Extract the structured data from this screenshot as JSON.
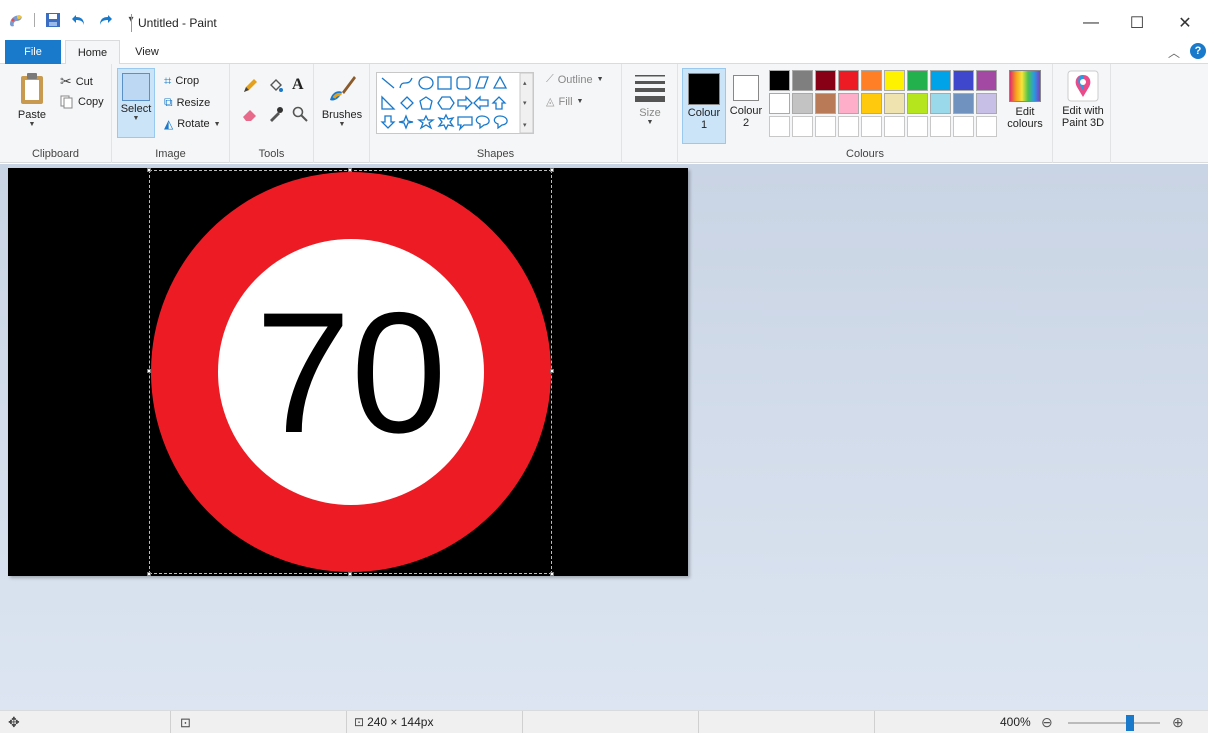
{
  "window": {
    "title": "Untitled - Paint"
  },
  "tabs": [
    {
      "label": "File"
    },
    {
      "label": "Home"
    },
    {
      "label": "View"
    }
  ],
  "ribbon": {
    "clipboard": {
      "group_label": "Clipboard",
      "paste": "Paste",
      "cut": "Cut",
      "copy": "Copy"
    },
    "image": {
      "group_label": "Image",
      "select": "Select",
      "crop": "Crop",
      "resize": "Resize",
      "rotate": "Rotate"
    },
    "tools": {
      "group_label": "Tools"
    },
    "brushes": {
      "label": "Brushes"
    },
    "shapes": {
      "group_label": "Shapes",
      "outline": "Outline",
      "fill": "Fill"
    },
    "size": {
      "label": "Size"
    },
    "colours": {
      "group_label": "Colours",
      "colour1": "Colour",
      "colour1_num": "1",
      "colour2": "Colour",
      "colour2_num": "2",
      "edit_colours_1": "Edit",
      "edit_colours_2": "colours",
      "colour1_value": "#000000",
      "colour2_value": "#ffffff",
      "palette_row1": [
        "#000000",
        "#7f7f7f",
        "#880015",
        "#ed1c24",
        "#ff7f27",
        "#fff200",
        "#22b14c",
        "#00a2e8",
        "#3f48cc",
        "#a349a4"
      ],
      "palette_row2": [
        "#ffffff",
        "#c3c3c3",
        "#b97a57",
        "#ffaec9",
        "#ffc90e",
        "#efe4b0",
        "#b5e61d",
        "#99d9ea",
        "#7092be",
        "#c8bfe7"
      ]
    },
    "paint3d": {
      "label1": "Edit with",
      "label2": "Paint 3D"
    }
  },
  "canvas": {
    "sign_text": "70",
    "sign_ring_color": "#ed1c24",
    "sign_center_color": "#ffffff",
    "background_color": "#000000"
  },
  "status": {
    "image_size": "240 × 144px",
    "zoom": "400%"
  }
}
